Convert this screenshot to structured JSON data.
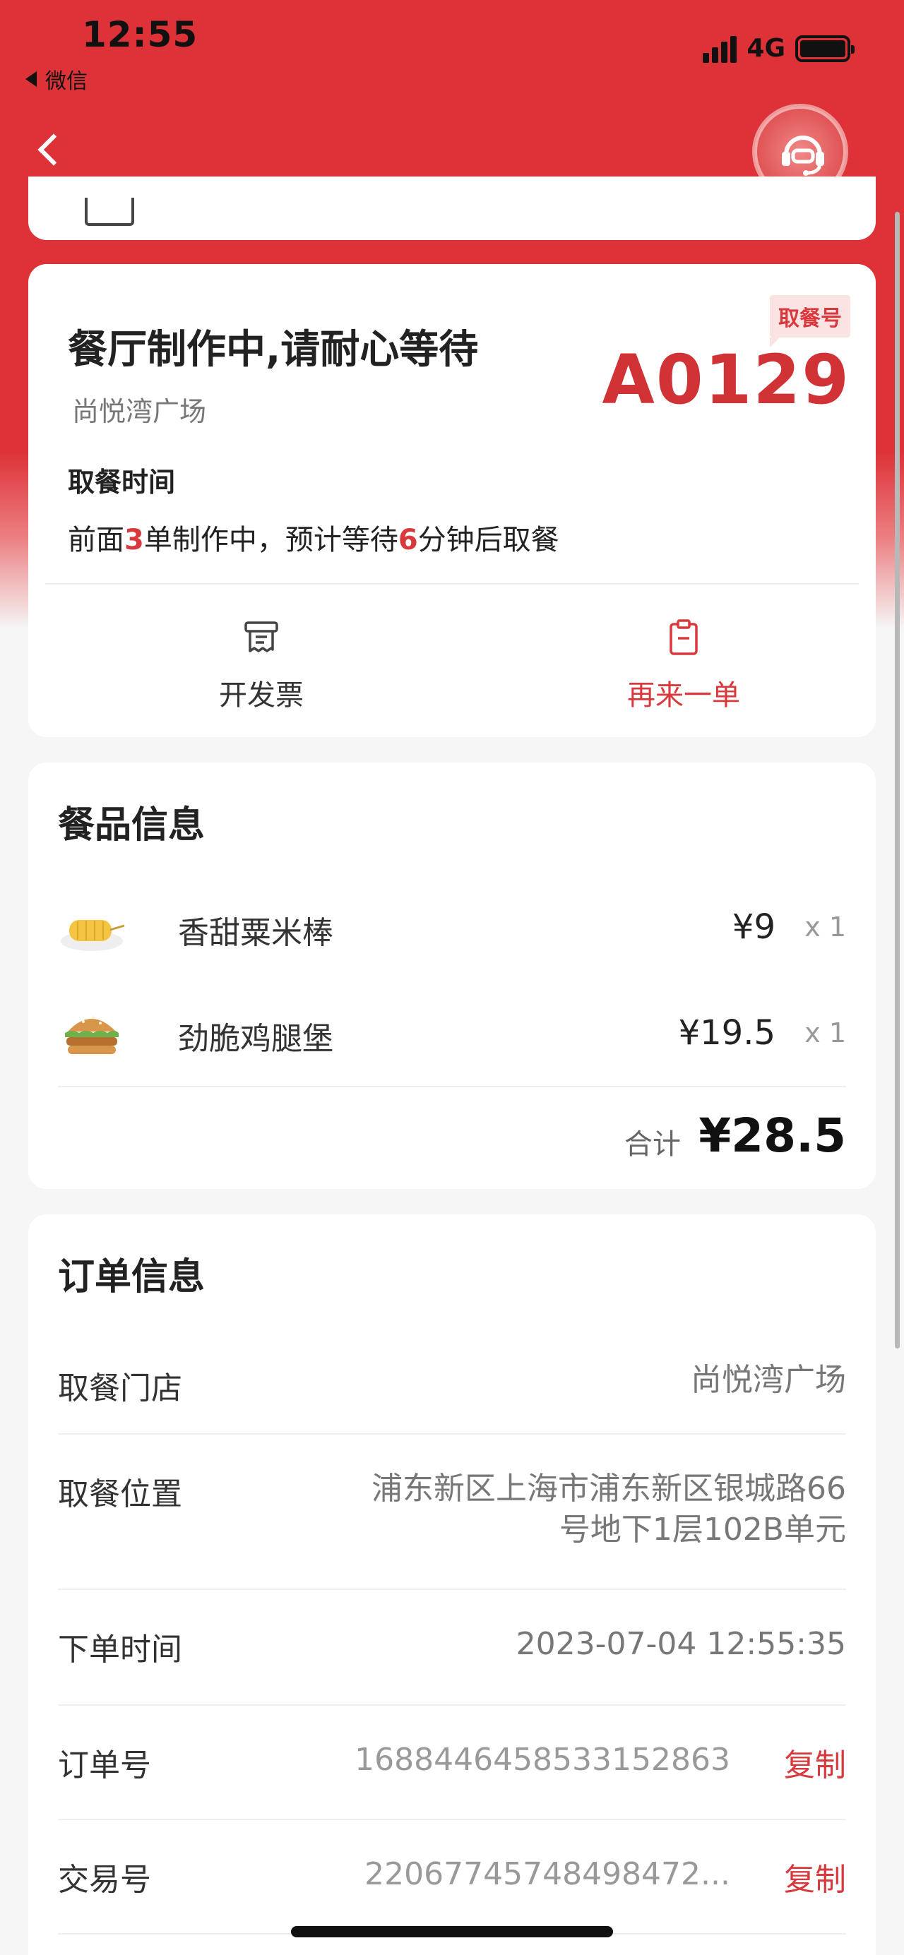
{
  "status_bar": {
    "time": "12:55",
    "back_app": "微信",
    "network": "4G"
  },
  "status": {
    "title": "餐厅制作中,请耐心等待",
    "store": "尚悦湾广场",
    "pickup_tag": "取餐号",
    "pickup_number": "A0129",
    "time_label": "取餐时间",
    "queue": {
      "prefix": "前面",
      "orders": "3",
      "middle": "单制作中，预计等待",
      "minutes": "6",
      "suffix": "分钟后取餐"
    },
    "actions": [
      {
        "label": "开发票",
        "icon": "receipt-icon"
      },
      {
        "label": "再来一单",
        "icon": "clipboard-icon"
      }
    ]
  },
  "food": {
    "title": "餐品信息",
    "items": [
      {
        "name": "香甜粟米棒",
        "price": "¥9",
        "qty": "x 1",
        "icon": "corn-icon"
      },
      {
        "name": "劲脆鸡腿堡",
        "price": "¥19.5",
        "qty": "x 1",
        "icon": "burger-icon"
      }
    ],
    "total_label": "合计",
    "total": "¥28.5"
  },
  "order": {
    "title": "订单信息",
    "store_label": "取餐门店",
    "store_value": "尚悦湾广场",
    "location_label": "取餐位置",
    "location_line1": "浦东新区上海市浦东新区银城路66",
    "location_line2": "号地下1层102B单元",
    "time_label": "下单时间",
    "time_value": "2023-07-04 12:55:35",
    "order_no_label": "订单号",
    "order_no": "1688446458533152863",
    "txn_label": "交易号",
    "txn_no": "22067745748498472...",
    "copy_label": "复制"
  },
  "colors": {
    "brand_red": "#dd3237",
    "accent_red": "#d9383c"
  }
}
